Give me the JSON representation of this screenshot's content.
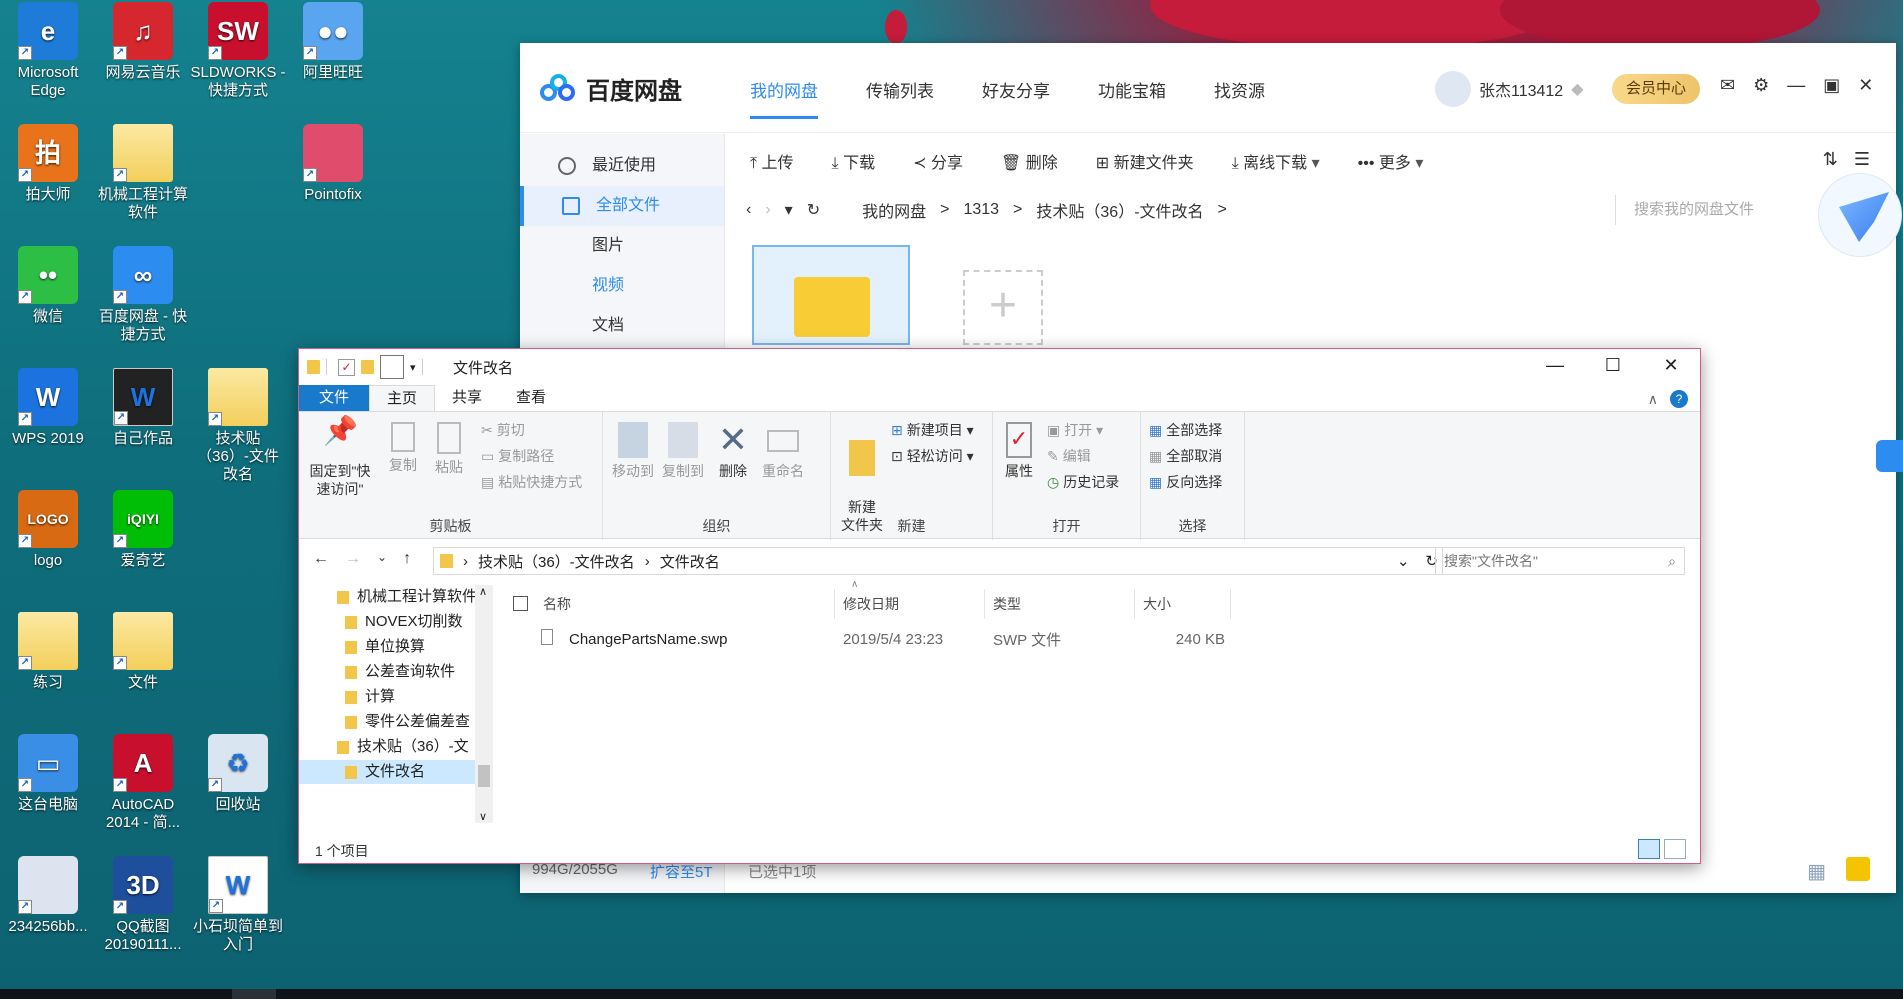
{
  "desktop": {
    "icons": [
      {
        "label": "Microsoft Edge",
        "glyph": "e",
        "color": "#1e7bd7"
      },
      {
        "label": "网易云音乐",
        "glyph": "♫",
        "color": "#d6262e"
      },
      {
        "label": "SLDWORKS - 快捷方式",
        "glyph": "SW",
        "color": "#c8102e"
      },
      {
        "label": "阿里旺旺",
        "glyph": "●●",
        "color": "#5aa5f0"
      },
      {
        "label": "拍大师",
        "glyph": "拍",
        "color": "#e8731a"
      },
      {
        "label": "机械工程计算软件",
        "glyph": "",
        "color": "#f3cf5b"
      },
      {
        "label": "Pointofix",
        "glyph": "",
        "color": "#e04c6b"
      },
      {
        "label": "微信",
        "glyph": "••",
        "color": "#2dbe45"
      },
      {
        "label": "百度网盘 - 快捷方式",
        "glyph": "∞",
        "color": "#2d8cf0"
      },
      {
        "label": "WPS 2019",
        "glyph": "W",
        "color": "#1c73e0"
      },
      {
        "label": "自己作品",
        "glyph": "W",
        "color": "#222222"
      },
      {
        "label": "技术贴（36）-文件改名",
        "glyph": "",
        "color": "#f3cf5b"
      },
      {
        "label": "logo",
        "glyph": "LOGO",
        "color": "#d86a14"
      },
      {
        "label": "爱奇艺",
        "glyph": "iQIYI",
        "color": "#00be06"
      },
      {
        "label": "练习",
        "glyph": "",
        "color": "#f3cf5b"
      },
      {
        "label": "文件",
        "glyph": "",
        "color": "#f3cf5b"
      },
      {
        "label": "这台电脑",
        "glyph": "▭",
        "color": "#3a8ee6"
      },
      {
        "label": "AutoCAD 2014 - 简...",
        "glyph": "A",
        "color": "#c8102e"
      },
      {
        "label": "回收站",
        "glyph": "♻",
        "color": "#d9e6f2"
      },
      {
        "label": "234256bb...",
        "glyph": "",
        "color": "#dde4ef"
      },
      {
        "label": "QQ截图20190111...",
        "glyph": "3D",
        "color": "#1d4f9c"
      },
      {
        "label": "小石坝简单到入门",
        "glyph": "W",
        "color": "#ffffff"
      }
    ]
  },
  "baidu": {
    "app_name": "百度网盘",
    "nav": [
      "我的网盘",
      "传输列表",
      "好友分享",
      "功能宝箱",
      "找资源"
    ],
    "user": "张杰113412",
    "vip": "会员中心",
    "sidebar": [
      "最近使用",
      "全部文件",
      "图片",
      "视频",
      "文档"
    ],
    "toolbar": [
      "上传",
      "下载",
      "分享",
      "删除",
      "新建文件夹",
      "离线下载",
      "更多"
    ],
    "path": [
      "我的网盘",
      "1313",
      "技术贴（36）-文件改名"
    ],
    "search_placeholder": "搜索我的网盘文件",
    "quota": "994G/2055G",
    "expand": "扩容至5T",
    "selected": "已选中1项"
  },
  "explorer": {
    "title": "文件改名",
    "tabs": [
      "文件",
      "主页",
      "共享",
      "查看"
    ],
    "groups": {
      "clipboard": {
        "label": "剪贴板",
        "pin": "固定到\"快速访问\"",
        "copy": "复制",
        "paste": "粘贴",
        "cut": "剪切",
        "copy_path": "复制路径",
        "paste_shortcut": "粘贴快捷方式"
      },
      "organize": {
        "label": "组织",
        "move_to": "移动到",
        "copy_to": "复制到",
        "delete": "删除",
        "rename": "重命名"
      },
      "new": {
        "label": "新建",
        "new_folder": "新建\n文件夹",
        "new_item": "新建项目 ▾",
        "easy_access": "轻松访问 ▾"
      },
      "open": {
        "label": "打开",
        "properties": "属性",
        "open": "打开 ▾",
        "edit": "编辑",
        "history": "历史记录"
      },
      "select": {
        "label": "选择",
        "select_all": "全部选择",
        "select_none": "全部取消",
        "invert": "反向选择"
      }
    },
    "address": [
      "技术贴（36）-文件改名",
      "文件改名"
    ],
    "search_placeholder": "搜索\"文件改名\"",
    "nav_tree": [
      "机械工程计算软件",
      "NOVEX切削数",
      "单位换算",
      "公差查询软件",
      "计算",
      "零件公差偏差查",
      "技术贴（36）-文",
      "文件改名"
    ],
    "columns": [
      "名称",
      "修改日期",
      "类型",
      "大小"
    ],
    "files": [
      {
        "name": "ChangePartsName.swp",
        "date": "2019/5/4 23:23",
        "type": "SWP 文件",
        "size": "240 KB"
      }
    ],
    "status": "1 个项目"
  }
}
